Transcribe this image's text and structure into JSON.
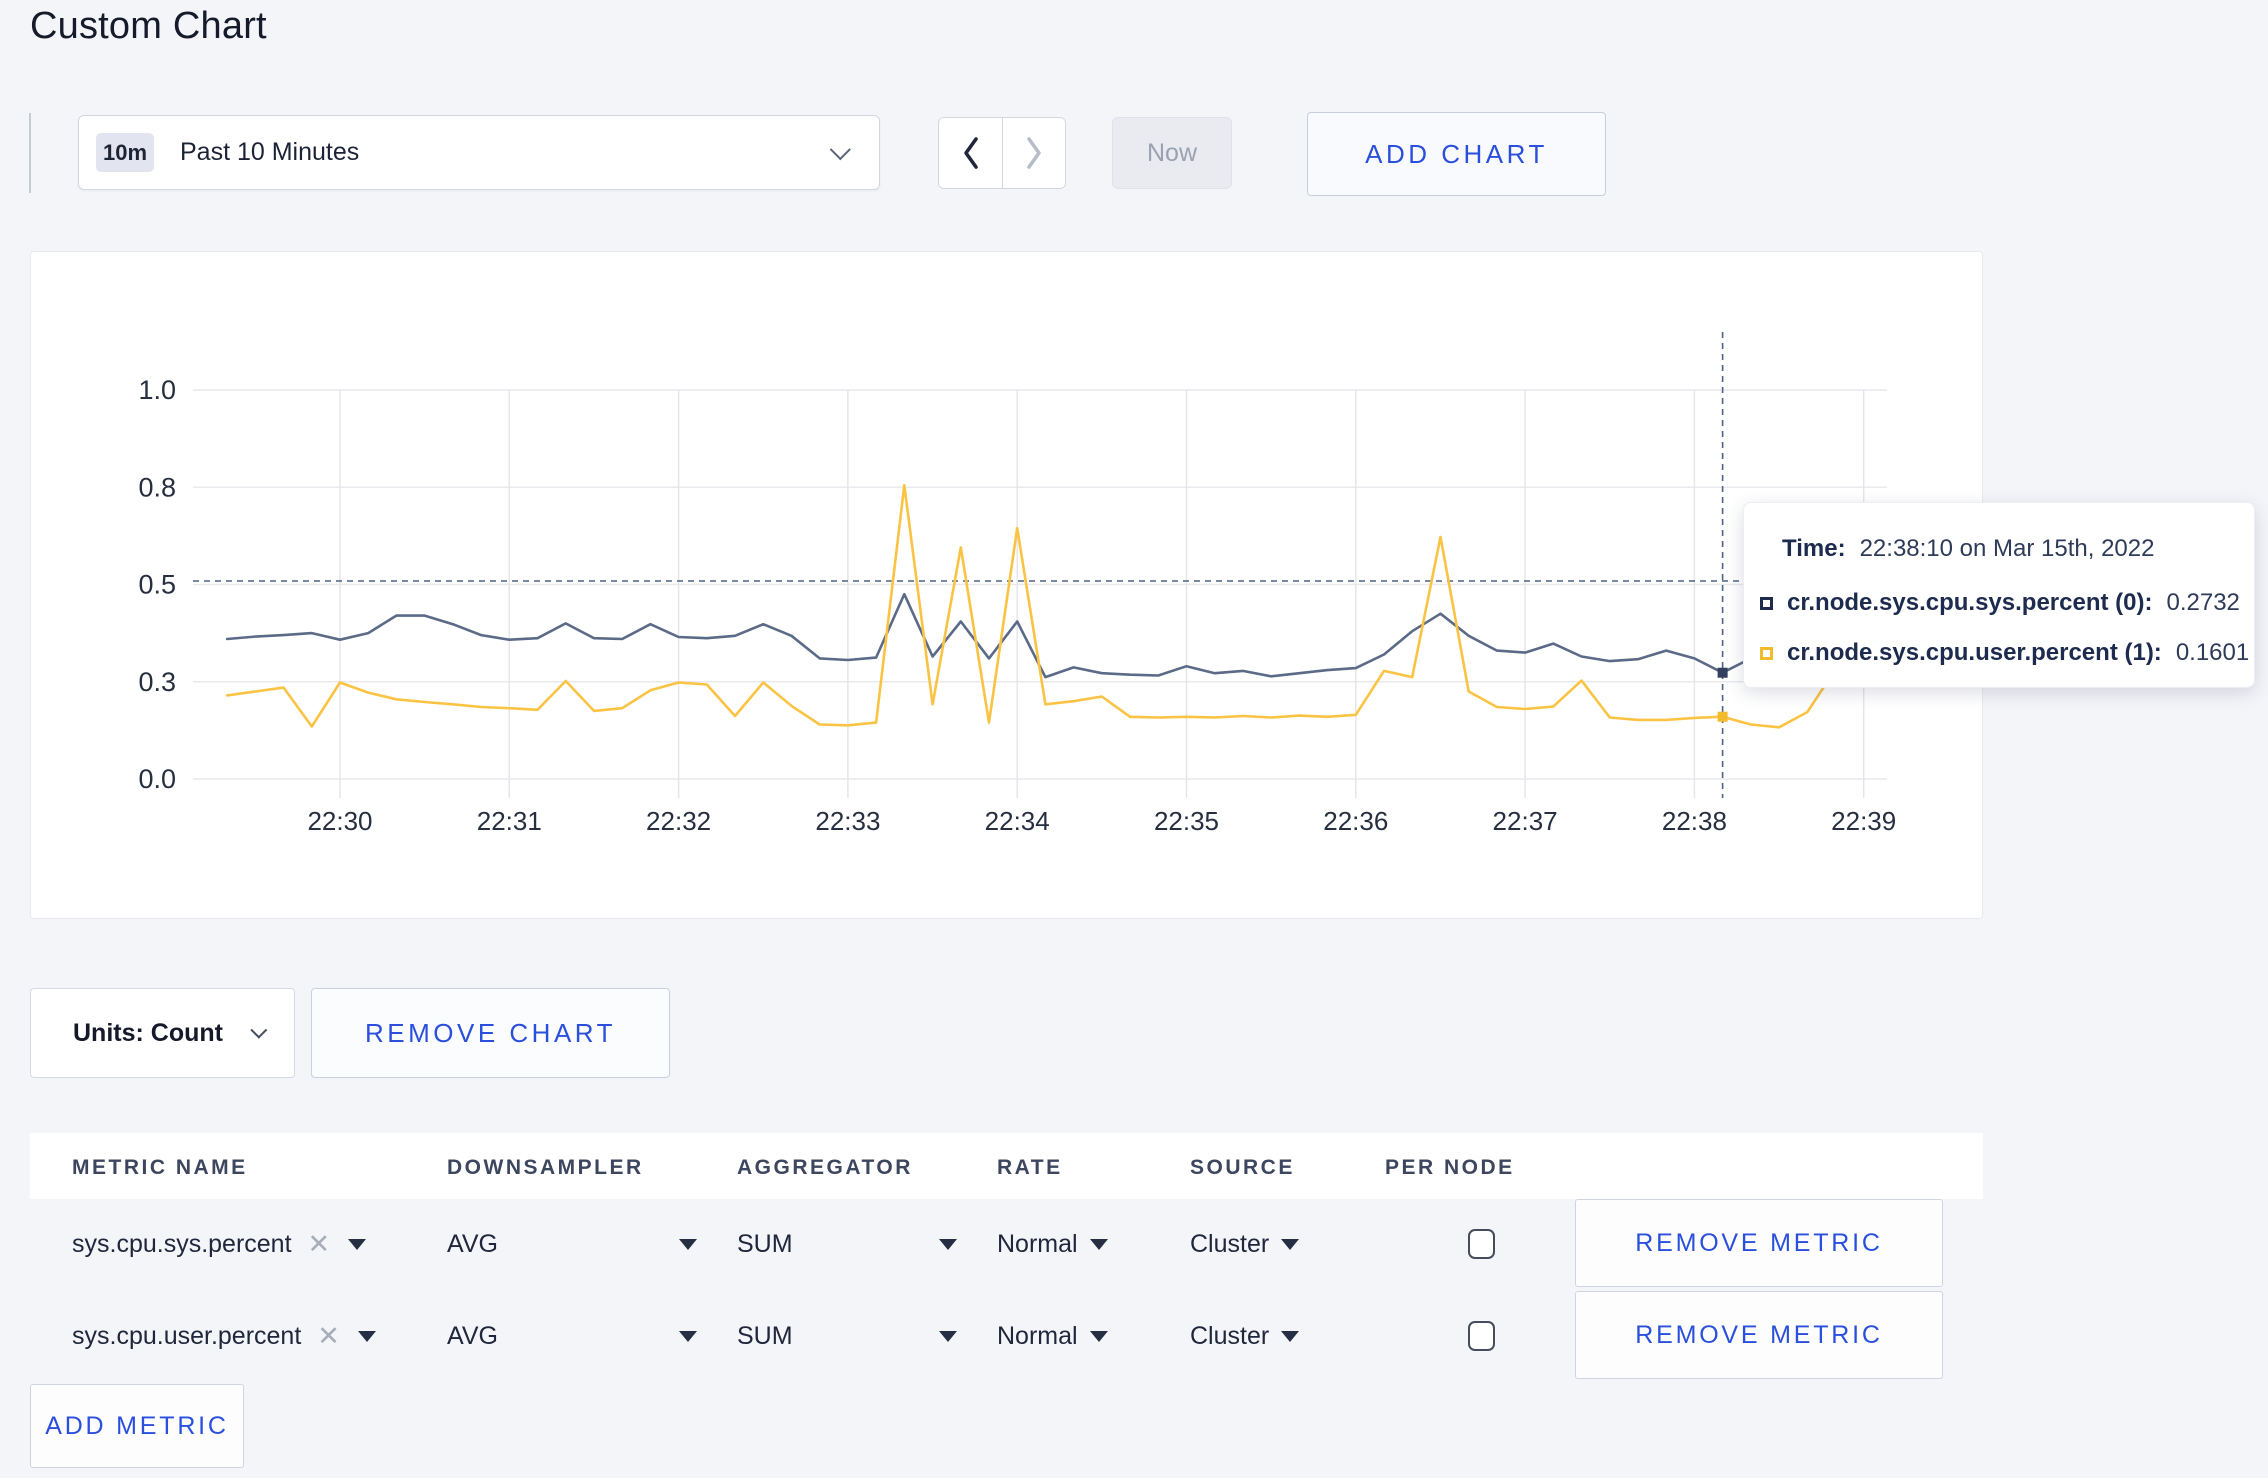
{
  "page": {
    "title": "Custom Chart"
  },
  "toolbar": {
    "time_badge": "10m",
    "time_label": "Past 10 Minutes",
    "now_label": "Now",
    "add_chart_label": "ADD CHART",
    "icons": {
      "dropdown": "chevron-down",
      "prev": "chevron-left",
      "next": "chevron-right"
    }
  },
  "chart": {
    "tooltip": {
      "time_label": "Time:",
      "time_value": "22:38:10 on Mar 15th, 2022",
      "rows": [
        {
          "name": "cr.node.sys.cpu.sys.percent (0):",
          "value": "0.2732",
          "swatch_color": "#1e2b4d"
        },
        {
          "name": "cr.node.sys.cpu.user.percent (1):",
          "value": "0.1601",
          "swatch_color": "#f2bb2d"
        }
      ]
    }
  },
  "chart_data": {
    "type": "line",
    "title": "",
    "xlabel": "",
    "ylabel": "",
    "ylim": [
      0,
      1
    ],
    "grid": true,
    "legend_position": "tooltip-only",
    "x_start": "22:29:20",
    "x_interval_seconds": 10,
    "x_ticks": [
      "22:30",
      "22:31",
      "22:32",
      "22:33",
      "22:34",
      "22:35",
      "22:36",
      "22:37",
      "22:38",
      "22:39"
    ],
    "y_ticks": [
      {
        "label": "0.0",
        "value": 0
      },
      {
        "label": "0.3",
        "value": 0.25
      },
      {
        "label": "0.5",
        "value": 0.5
      },
      {
        "label": "0.8",
        "value": 0.75
      },
      {
        "label": "1.0",
        "value": 1
      }
    ],
    "series": [
      {
        "name": "cr.node.sys.cpu.sys.percent (0)",
        "color": "#5b6a86",
        "dot_color": "#333f5e",
        "values": [
          0.36,
          0.366,
          0.37,
          0.375,
          0.358,
          0.375,
          0.42,
          0.42,
          0.398,
          0.37,
          0.358,
          0.362,
          0.4,
          0.362,
          0.36,
          0.398,
          0.365,
          0.362,
          0.368,
          0.398,
          0.368,
          0.31,
          0.306,
          0.312,
          0.475,
          0.315,
          0.405,
          0.31,
          0.405,
          0.262,
          0.287,
          0.272,
          0.268,
          0.266,
          0.29,
          0.272,
          0.278,
          0.264,
          0.272,
          0.28,
          0.285,
          0.32,
          0.38,
          0.425,
          0.368,
          0.33,
          0.325,
          0.348,
          0.315,
          0.303,
          0.308,
          0.33,
          0.31,
          0.2732,
          0.31,
          0.315,
          0.305,
          0.298,
          0.293,
          0.31
        ]
      },
      {
        "name": "cr.node.sys.cpu.user.percent (1)",
        "color": "#fbc343",
        "dot_color": "#f2bb2d",
        "values": [
          0.215,
          0.225,
          0.235,
          0.135,
          0.248,
          0.222,
          0.205,
          0.198,
          0.192,
          0.185,
          0.182,
          0.178,
          0.252,
          0.175,
          0.182,
          0.228,
          0.248,
          0.243,
          0.162,
          0.248,
          0.188,
          0.14,
          0.138,
          0.145,
          0.755,
          0.192,
          0.595,
          0.145,
          0.645,
          0.192,
          0.2,
          0.212,
          0.16,
          0.158,
          0.16,
          0.158,
          0.162,
          0.158,
          0.163,
          0.16,
          0.165,
          0.278,
          0.262,
          0.622,
          0.225,
          0.185,
          0.18,
          0.186,
          0.253,
          0.158,
          0.152,
          0.152,
          0.157,
          0.1601,
          0.14,
          0.133,
          0.172,
          0.282,
          0.298,
          0.242
        ]
      }
    ],
    "crosshair": {
      "time": "22:38:10",
      "x_index": 53,
      "hline_value": 0.509,
      "values": {
        "sys": 0.2732,
        "user": 0.1601
      }
    }
  },
  "units": {
    "label": "Units: Count"
  },
  "remove_chart_label": "REMOVE CHART",
  "metrics_table": {
    "columns": [
      "METRIC NAME",
      "DOWNSAMPLER",
      "AGGREGATOR",
      "RATE",
      "SOURCE",
      "PER NODE"
    ],
    "rows": [
      {
        "name": "sys.cpu.sys.percent",
        "downsampler": "AVG",
        "aggregator": "SUM",
        "rate": "Normal",
        "source": "Cluster",
        "per_node_checked": false,
        "remove_label": "REMOVE METRIC"
      },
      {
        "name": "sys.cpu.user.percent",
        "downsampler": "AVG",
        "aggregator": "SUM",
        "rate": "Normal",
        "source": "Cluster",
        "per_node_checked": false,
        "remove_label": "REMOVE METRIC"
      }
    ],
    "add_metric_label": "ADD METRIC"
  },
  "colors": {
    "accent_blue": "#2a4fdc",
    "page_background": "#f4f5f9",
    "series_sys": "#5b6a86",
    "series_user": "#fbc343",
    "crosshair": "#4a6482",
    "gridline": "#e9e9ee"
  }
}
